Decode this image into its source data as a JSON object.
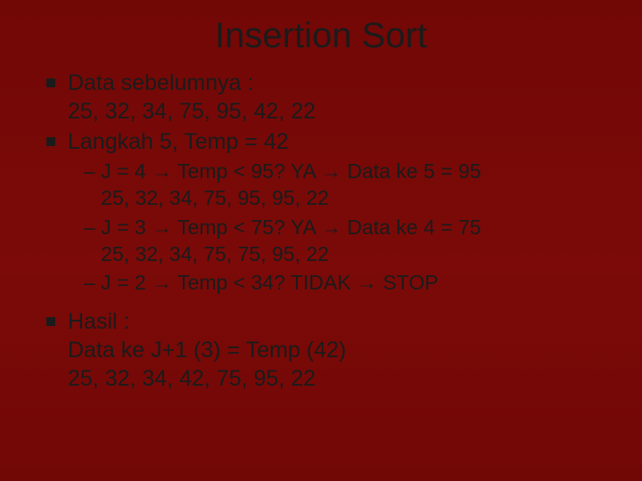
{
  "title": "Insertion Sort",
  "b1": {
    "l1": "Data sebelumnya :",
    "l2": "25, 32, 34, 75, 95, 42, 22"
  },
  "b2": {
    "l1": "Langkah 5, Temp = 42"
  },
  "sub": {
    "s1a": "– J = 4 → Temp < 95? YA → Data ke 5 = 95",
    "s1b": "   25, 32, 34, 75, 95, 95, 22",
    "s2a": "– J = 3 → Temp < 75? YA → Data ke 4 = 75",
    "s2b": "   25, 32, 34, 75, 75, 95, 22",
    "s3a": "– J = 2 → Temp < 34? TIDAK → STOP"
  },
  "b3": {
    "l1": "Hasil :",
    "l2": "Data ke J+1 (3) = Temp (42)",
    "l3": "25, 32, 34, 42, 75, 95, 22"
  }
}
